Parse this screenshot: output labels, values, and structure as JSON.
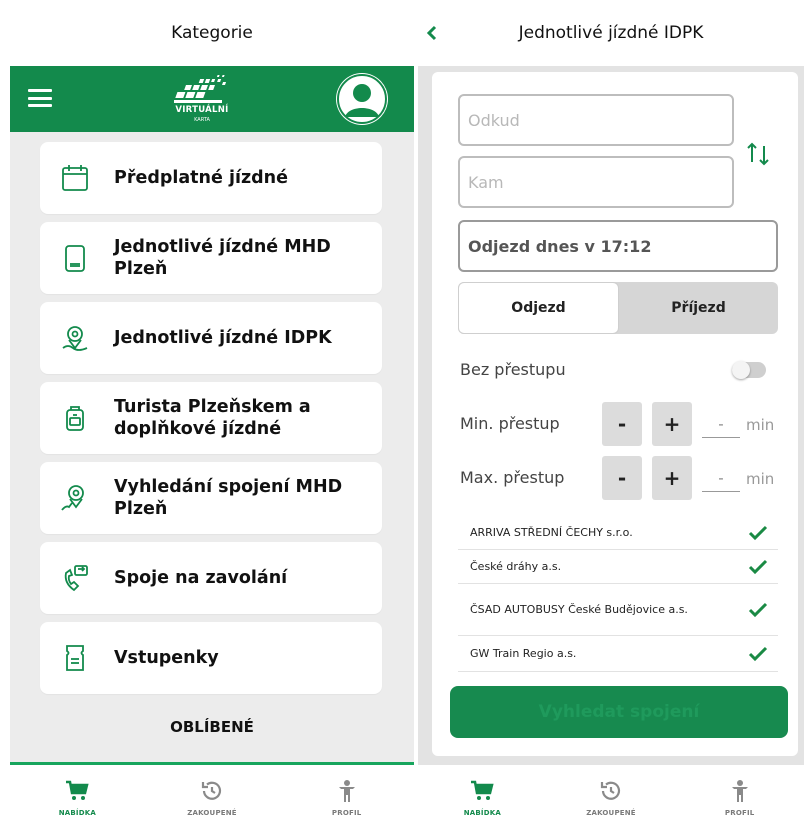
{
  "left_screen": {
    "title": "Kategorie",
    "logo": {
      "text": "VIRTUÁLNÍ",
      "subtext": "KARTA"
    },
    "menu_items": [
      {
        "label": "Předplatné jízdné",
        "icon": "calendar-icon"
      },
      {
        "label": "Jednotlivé jízdné MHD Plzeň",
        "icon": "card-icon"
      },
      {
        "label": "Jednotlivé jízdné IDPK",
        "icon": "map-pin-icon"
      },
      {
        "label": "Turista Plzeňskem a doplňkové jízdné",
        "icon": "backpack-icon"
      },
      {
        "label": "Vyhledání spojení MHD Plzeň",
        "icon": "route-pin-icon"
      },
      {
        "label": "Spoje na zavolání",
        "icon": "phone-icon"
      },
      {
        "label": "Vstupenky",
        "icon": "ticket-icon"
      }
    ],
    "favorites_heading": "OBLÍBENÉ"
  },
  "right_screen": {
    "title": "Jednotlivé jízdné IDPK",
    "from_placeholder": "Odkud",
    "to_placeholder": "Kam",
    "departure_time": "Odjezd dnes v 17:12",
    "segment": {
      "options": [
        "Odjezd",
        "Příjezd"
      ],
      "selected": "Odjezd"
    },
    "no_transfer": {
      "label": "Bez přestupu",
      "enabled": false
    },
    "min_transfer": {
      "label": "Min. přestup",
      "minus": "-",
      "plus": "+",
      "value": "-",
      "unit": "min"
    },
    "max_transfer": {
      "label": "Max. přestup",
      "minus": "-",
      "plus": "+",
      "value": "-",
      "unit": "min"
    },
    "carriers": [
      {
        "name": "ARRIVA STŘEDNÍ ČECHY s.r.o.",
        "checked": true
      },
      {
        "name": "České dráhy a.s.",
        "checked": true
      },
      {
        "name": "ČSAD AUTOBUSY České Budějovice a.s.",
        "checked": true
      },
      {
        "name": "GW Train Regio a.s.",
        "checked": true
      }
    ],
    "search_button": "Vyhledat spojení"
  },
  "tabbar": [
    {
      "label": "NABÍDKA",
      "icon": "cart-icon",
      "active": true
    },
    {
      "label": "ZAKOUPENÉ",
      "icon": "history-icon",
      "active": false
    },
    {
      "label": "PROFIL",
      "icon": "person-icon",
      "active": false
    }
  ],
  "colors": {
    "brand_green": "#138a4c",
    "accent_green": "#17a55d",
    "check_green": "#1a8a44",
    "inactive_gray": "#7a7a7a"
  }
}
